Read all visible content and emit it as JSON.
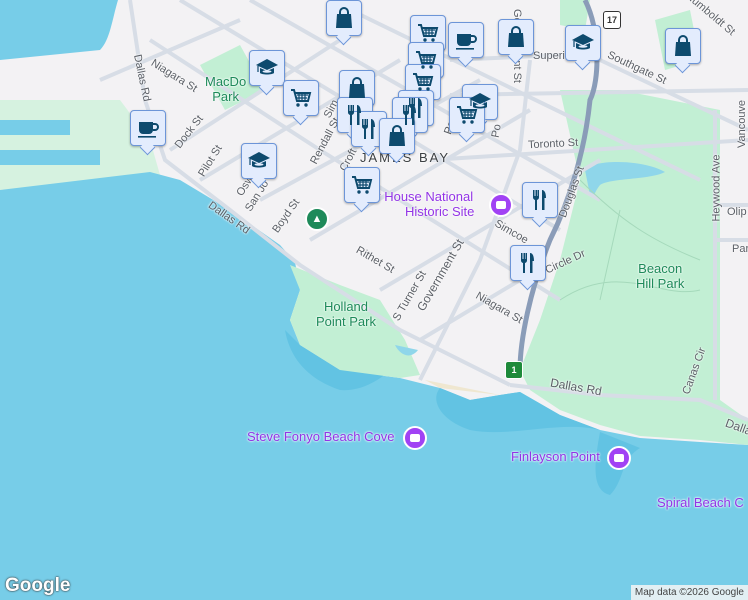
{
  "colors": {
    "water": "#77cde8",
    "park": "#c2efd4",
    "road": "#d7dde6",
    "highway": "#8a9cb8",
    "marker_fill": "#e3ecfd",
    "marker_icon": "#0d4a6e"
  },
  "streets": {
    "dallas_rd_north": "Dallas Rd",
    "niagara_west": "Niagara St",
    "dock": "Dock St",
    "pilot": "Pilot St",
    "oswego": "Oswego",
    "san_jose": "San Jo",
    "boyd": "Boyd St",
    "dallas_rd_west": "Dallas Rd",
    "rendall": "Rendall St",
    "croft": "Croft St",
    "simcoe_north": "Sim",
    "toronto": "Toronto St",
    "superior": "Superi",
    "government_north": "Government St",
    "southgate": "Southgate St",
    "humboldt": "Humboldt St",
    "douglas": "Douglas St",
    "simcoe_east": "Simcoe",
    "rithet": "Rithet St",
    "s_turner": "S Turner St",
    "government_south": "Government St",
    "niagara_east": "Niagara St",
    "circle_dr": "Circle Dr",
    "heywood": "Heywood Ave",
    "vancouver": "Vancouve",
    "oliphant": "Olip",
    "park_blvd": "Par",
    "dallas_rd_south": "Dallas Rd",
    "dallas_rd_east": "Dalla",
    "canas": "Canas Cir",
    "paris": "Par",
    "pon": "Po"
  },
  "places": {
    "district": "JAMES BAY",
    "macdonald_park": [
      "MacDo",
      "Park"
    ],
    "holland_point_park": [
      "Holland",
      "Point Park"
    ],
    "beacon_hill_park": [
      "Beacon",
      "Hill Park"
    ],
    "emily_carr": [
      "r House National",
      "Historic Site"
    ],
    "steve_fonyo": "Steve Fonyo Beach Cove",
    "finlayson_point": "Finlayson Point",
    "spiral_beach": "Spiral Beach C"
  },
  "shields": {
    "hwy17": "17",
    "hwy1": "1"
  },
  "markers": [
    "shopping-bag",
    "shopping-cart",
    "coffee-cup",
    "graduation-cap",
    "fork-knife"
  ],
  "footer": {
    "logo": "Google",
    "attribution": "Map data ©2026 Google"
  }
}
